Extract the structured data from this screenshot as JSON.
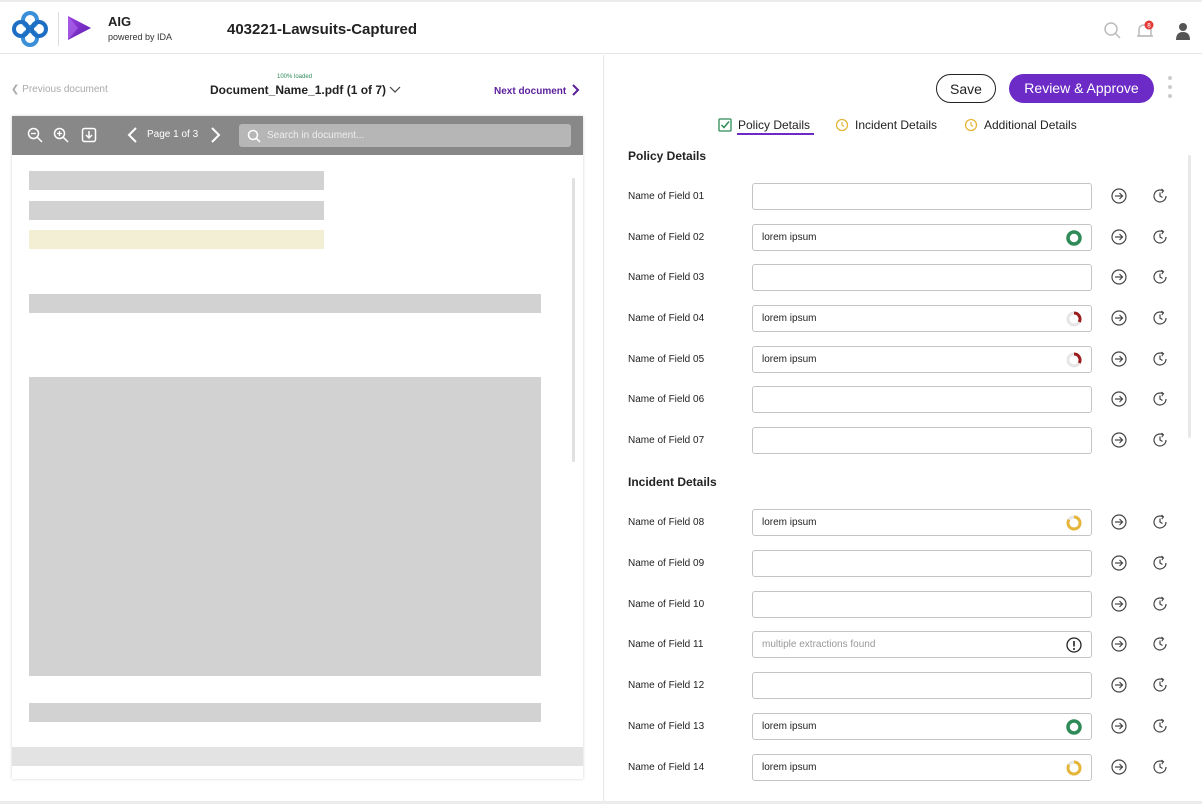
{
  "header": {
    "brand_name": "AIG",
    "brand_sub": "powered by IDA",
    "doc_title": "403221-Lawsuits-Captured",
    "notification_count": "8",
    "icons": [
      "flower-logo-icon",
      "play-logo-icon",
      "search-icon",
      "bell-icon",
      "user-icon"
    ]
  },
  "viewer": {
    "prev_label": "Previous document",
    "next_label": "Next document",
    "loaded_text": "100% loaded",
    "doc_name": "Document_Name_1.pdf (1 of 7)",
    "page_info": "Page 1 of 3",
    "search_placeholder": "Search in document..."
  },
  "actions": {
    "save_label": "Save",
    "approve_label": "Review & Approve"
  },
  "tabs": [
    {
      "label": "Policy Details",
      "active": true
    },
    {
      "label": "Incident Details",
      "active": false
    },
    {
      "label": "Additional Details",
      "active": false
    }
  ],
  "sections": {
    "policy": "Policy Details",
    "incident": "Incident Details"
  },
  "fields": [
    {
      "label": "Name of Field 01",
      "value": "",
      "status": "none"
    },
    {
      "label": "Name of Field 02",
      "value": "lorem ipsum",
      "status": "complete-green"
    },
    {
      "label": "Name of Field 03",
      "value": "",
      "status": "none"
    },
    {
      "label": "Name of Field 04",
      "value": "lorem ipsum",
      "status": "low-red"
    },
    {
      "label": "Name of Field 05",
      "value": "lorem ipsum",
      "status": "low-red"
    },
    {
      "label": "Name of Field 06",
      "value": "",
      "status": "none"
    },
    {
      "label": "Name of Field 07",
      "value": "",
      "status": "none"
    },
    {
      "label": "Name of Field 08",
      "value": "lorem ipsum",
      "status": "high-yellow"
    },
    {
      "label": "Name of Field 09",
      "value": "",
      "status": "none"
    },
    {
      "label": "Name of Field 10",
      "value": "",
      "status": "none"
    },
    {
      "label": "Name of Field 11",
      "value": "",
      "placeholder": "multiple extractions found",
      "status": "alert"
    },
    {
      "label": "Name of Field 12",
      "value": "",
      "status": "none"
    },
    {
      "label": "Name of Field 13",
      "value": "lorem ipsum",
      "status": "complete-green"
    },
    {
      "label": "Name of Field 14",
      "value": "lorem ipsum",
      "status": "high-yellow"
    }
  ],
  "colors": {
    "accent": "#6c2bc6",
    "green": "#2e8b57",
    "red": "#9b1c1c",
    "yellow": "#e5b63a"
  }
}
